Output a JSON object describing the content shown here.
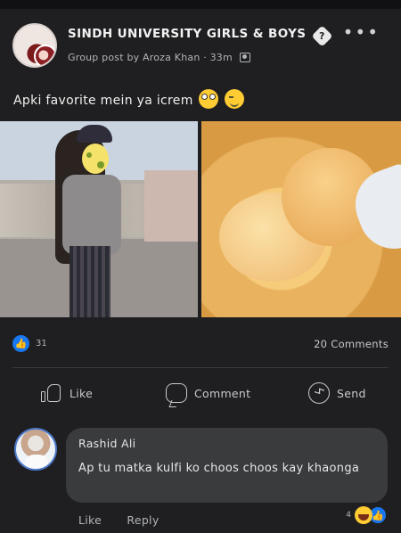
{
  "post": {
    "group_name": "SINDH UNIVERSITY GIRLS & BOYS",
    "verified_glyph": "?",
    "meta_prefix": "Group post by",
    "author": "Aroza Khan",
    "separator": "·",
    "time": "33m",
    "more_glyph": "•••",
    "caption": "Apki favorite mein ya icrem"
  },
  "stats": {
    "like_count": "31",
    "comments": "20 Comments",
    "like_glyph": "👍"
  },
  "actions": {
    "like": "Like",
    "comment": "Comment",
    "send": "Send"
  },
  "comment": {
    "author": "Rashid Ali",
    "text": "Ap tu matka kulfi ko choos choos kay khaonga",
    "like_action": "Like",
    "reply_action": "Reply",
    "reaction_count": "4",
    "reactions": [
      "laugh-icon",
      "like-icon"
    ]
  },
  "colors": {
    "background": "#1f1f21",
    "bubble": "#3a3b3c",
    "accent": "#1877f2"
  }
}
